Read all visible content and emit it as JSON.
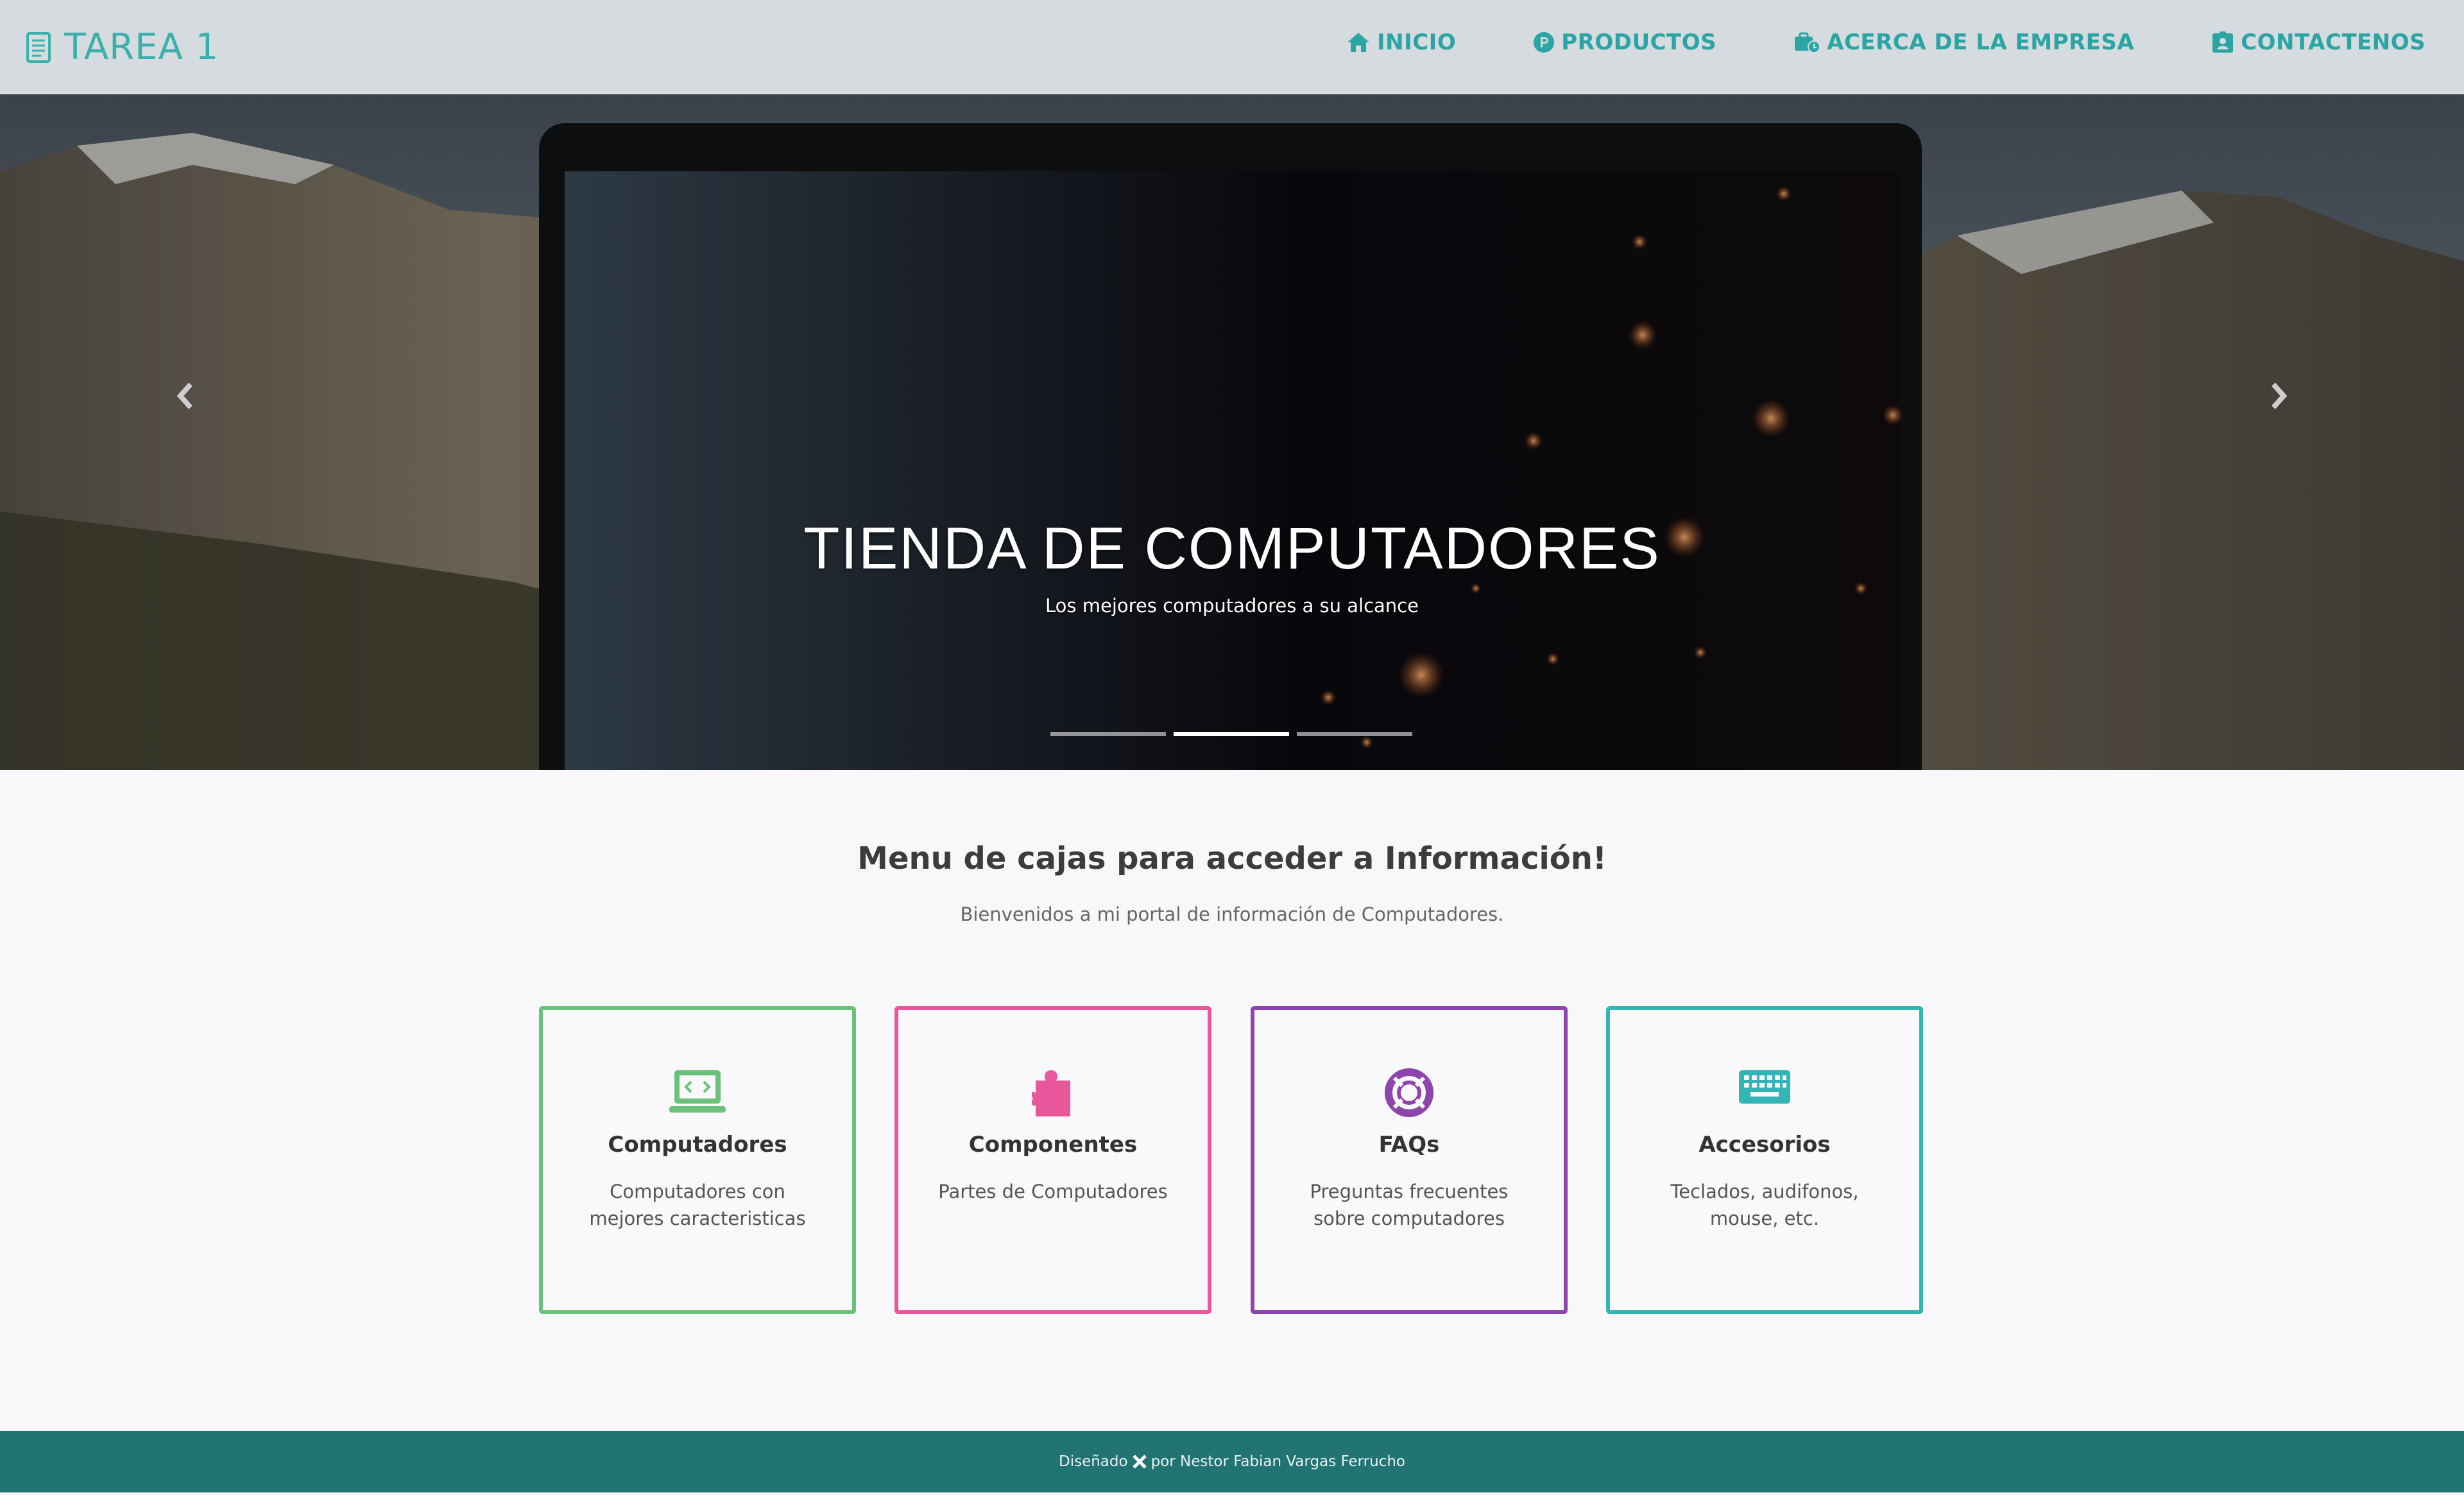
{
  "brand": {
    "title": "TAREA 1",
    "icon": "document-icon"
  },
  "nav": {
    "items": [
      {
        "label": "INICIO",
        "icon": "home-icon"
      },
      {
        "label": "PRODUCTOS",
        "icon": "product-p-icon"
      },
      {
        "label": "ACERCA DE LA EMPRESA",
        "icon": "business-icon"
      },
      {
        "label": "CONTACTENOS",
        "icon": "contact-card-icon"
      }
    ]
  },
  "hero": {
    "title": "TIENDA DE COMPUTADORES",
    "subtitle": "Los mejores computadores a su alcance",
    "slides": 3,
    "active_slide": 2
  },
  "section": {
    "title": "Menu de cajas para acceder a Información!",
    "subtitle": "Bienvenidos a mi portal de información de Computadores."
  },
  "cards": [
    {
      "title": "Computadores",
      "desc": "Computadores con mejores caracteristicas",
      "color": "#6cc17a",
      "icon": "laptop-code-icon"
    },
    {
      "title": "Componentes",
      "desc": "Partes de Computadores",
      "color": "#e8579c",
      "icon": "puzzle-piece-icon"
    },
    {
      "title": "FAQs",
      "desc": "Preguntas frecuentes sobre computadores",
      "color": "#8e44ad",
      "icon": "life-ring-icon"
    },
    {
      "title": "Accesorios",
      "desc": "Teclados, audifonos, mouse, etc.",
      "color": "#33b4b6",
      "icon": "keyboard-icon"
    }
  ],
  "footer": {
    "prefix": "Diseñado",
    "suffix": "por Nestor Fabian Vargas Ferrucho",
    "icon": "tools-icon"
  },
  "colors": {
    "accent": "#2aa5a4",
    "navbar": "#d5dbdf",
    "footer": "#217473",
    "background": "#f8f8fa"
  }
}
